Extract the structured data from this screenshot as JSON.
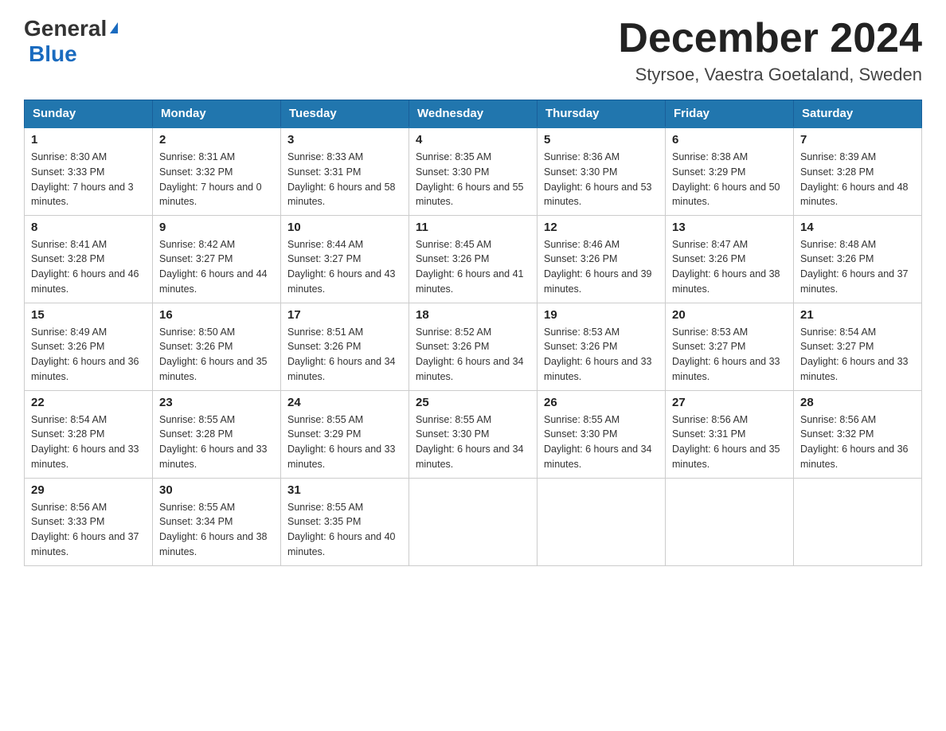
{
  "header": {
    "logo_general": "General",
    "logo_blue": "Blue",
    "month_title": "December 2024",
    "location": "Styrsoe, Vaestra Goetaland, Sweden"
  },
  "days_of_week": [
    "Sunday",
    "Monday",
    "Tuesday",
    "Wednesday",
    "Thursday",
    "Friday",
    "Saturday"
  ],
  "weeks": [
    [
      {
        "day": "1",
        "sunrise": "Sunrise: 8:30 AM",
        "sunset": "Sunset: 3:33 PM",
        "daylight": "Daylight: 7 hours and 3 minutes."
      },
      {
        "day": "2",
        "sunrise": "Sunrise: 8:31 AM",
        "sunset": "Sunset: 3:32 PM",
        "daylight": "Daylight: 7 hours and 0 minutes."
      },
      {
        "day": "3",
        "sunrise": "Sunrise: 8:33 AM",
        "sunset": "Sunset: 3:31 PM",
        "daylight": "Daylight: 6 hours and 58 minutes."
      },
      {
        "day": "4",
        "sunrise": "Sunrise: 8:35 AM",
        "sunset": "Sunset: 3:30 PM",
        "daylight": "Daylight: 6 hours and 55 minutes."
      },
      {
        "day": "5",
        "sunrise": "Sunrise: 8:36 AM",
        "sunset": "Sunset: 3:30 PM",
        "daylight": "Daylight: 6 hours and 53 minutes."
      },
      {
        "day": "6",
        "sunrise": "Sunrise: 8:38 AM",
        "sunset": "Sunset: 3:29 PM",
        "daylight": "Daylight: 6 hours and 50 minutes."
      },
      {
        "day": "7",
        "sunrise": "Sunrise: 8:39 AM",
        "sunset": "Sunset: 3:28 PM",
        "daylight": "Daylight: 6 hours and 48 minutes."
      }
    ],
    [
      {
        "day": "8",
        "sunrise": "Sunrise: 8:41 AM",
        "sunset": "Sunset: 3:28 PM",
        "daylight": "Daylight: 6 hours and 46 minutes."
      },
      {
        "day": "9",
        "sunrise": "Sunrise: 8:42 AM",
        "sunset": "Sunset: 3:27 PM",
        "daylight": "Daylight: 6 hours and 44 minutes."
      },
      {
        "day": "10",
        "sunrise": "Sunrise: 8:44 AM",
        "sunset": "Sunset: 3:27 PM",
        "daylight": "Daylight: 6 hours and 43 minutes."
      },
      {
        "day": "11",
        "sunrise": "Sunrise: 8:45 AM",
        "sunset": "Sunset: 3:26 PM",
        "daylight": "Daylight: 6 hours and 41 minutes."
      },
      {
        "day": "12",
        "sunrise": "Sunrise: 8:46 AM",
        "sunset": "Sunset: 3:26 PM",
        "daylight": "Daylight: 6 hours and 39 minutes."
      },
      {
        "day": "13",
        "sunrise": "Sunrise: 8:47 AM",
        "sunset": "Sunset: 3:26 PM",
        "daylight": "Daylight: 6 hours and 38 minutes."
      },
      {
        "day": "14",
        "sunrise": "Sunrise: 8:48 AM",
        "sunset": "Sunset: 3:26 PM",
        "daylight": "Daylight: 6 hours and 37 minutes."
      }
    ],
    [
      {
        "day": "15",
        "sunrise": "Sunrise: 8:49 AM",
        "sunset": "Sunset: 3:26 PM",
        "daylight": "Daylight: 6 hours and 36 minutes."
      },
      {
        "day": "16",
        "sunrise": "Sunrise: 8:50 AM",
        "sunset": "Sunset: 3:26 PM",
        "daylight": "Daylight: 6 hours and 35 minutes."
      },
      {
        "day": "17",
        "sunrise": "Sunrise: 8:51 AM",
        "sunset": "Sunset: 3:26 PM",
        "daylight": "Daylight: 6 hours and 34 minutes."
      },
      {
        "day": "18",
        "sunrise": "Sunrise: 8:52 AM",
        "sunset": "Sunset: 3:26 PM",
        "daylight": "Daylight: 6 hours and 34 minutes."
      },
      {
        "day": "19",
        "sunrise": "Sunrise: 8:53 AM",
        "sunset": "Sunset: 3:26 PM",
        "daylight": "Daylight: 6 hours and 33 minutes."
      },
      {
        "day": "20",
        "sunrise": "Sunrise: 8:53 AM",
        "sunset": "Sunset: 3:27 PM",
        "daylight": "Daylight: 6 hours and 33 minutes."
      },
      {
        "day": "21",
        "sunrise": "Sunrise: 8:54 AM",
        "sunset": "Sunset: 3:27 PM",
        "daylight": "Daylight: 6 hours and 33 minutes."
      }
    ],
    [
      {
        "day": "22",
        "sunrise": "Sunrise: 8:54 AM",
        "sunset": "Sunset: 3:28 PM",
        "daylight": "Daylight: 6 hours and 33 minutes."
      },
      {
        "day": "23",
        "sunrise": "Sunrise: 8:55 AM",
        "sunset": "Sunset: 3:28 PM",
        "daylight": "Daylight: 6 hours and 33 minutes."
      },
      {
        "day": "24",
        "sunrise": "Sunrise: 8:55 AM",
        "sunset": "Sunset: 3:29 PM",
        "daylight": "Daylight: 6 hours and 33 minutes."
      },
      {
        "day": "25",
        "sunrise": "Sunrise: 8:55 AM",
        "sunset": "Sunset: 3:30 PM",
        "daylight": "Daylight: 6 hours and 34 minutes."
      },
      {
        "day": "26",
        "sunrise": "Sunrise: 8:55 AM",
        "sunset": "Sunset: 3:30 PM",
        "daylight": "Daylight: 6 hours and 34 minutes."
      },
      {
        "day": "27",
        "sunrise": "Sunrise: 8:56 AM",
        "sunset": "Sunset: 3:31 PM",
        "daylight": "Daylight: 6 hours and 35 minutes."
      },
      {
        "day": "28",
        "sunrise": "Sunrise: 8:56 AM",
        "sunset": "Sunset: 3:32 PM",
        "daylight": "Daylight: 6 hours and 36 minutes."
      }
    ],
    [
      {
        "day": "29",
        "sunrise": "Sunrise: 8:56 AM",
        "sunset": "Sunset: 3:33 PM",
        "daylight": "Daylight: 6 hours and 37 minutes."
      },
      {
        "day": "30",
        "sunrise": "Sunrise: 8:55 AM",
        "sunset": "Sunset: 3:34 PM",
        "daylight": "Daylight: 6 hours and 38 minutes."
      },
      {
        "day": "31",
        "sunrise": "Sunrise: 8:55 AM",
        "sunset": "Sunset: 3:35 PM",
        "daylight": "Daylight: 6 hours and 40 minutes."
      },
      null,
      null,
      null,
      null
    ]
  ]
}
